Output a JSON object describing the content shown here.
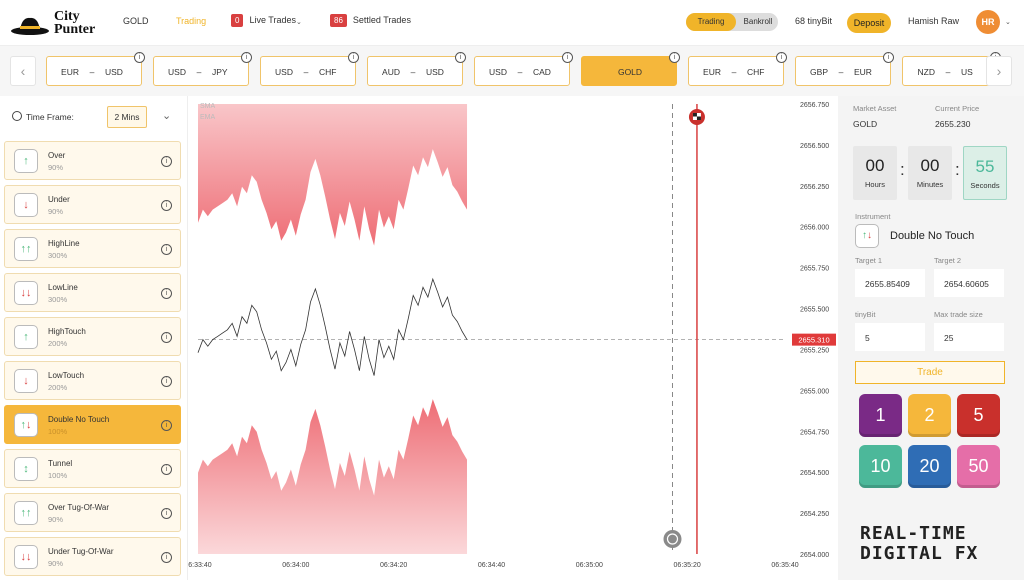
{
  "logo": {
    "line1": "City",
    "line2": "Punter"
  },
  "nav": {
    "asset": "GOLD",
    "trading": "Trading",
    "live_count": "0",
    "live_label": "Live Trades",
    "settled_count": "86",
    "settled_label": "Settled Trades",
    "mode_on": "Trading",
    "mode_off": "Bankroll",
    "balance": "68 tinyBit",
    "deposit": "Deposit",
    "user": "Hamish Raw",
    "initials": "HR"
  },
  "pairs": [
    {
      "a": "EUR",
      "b": "USD"
    },
    {
      "a": "USD",
      "b": "JPY"
    },
    {
      "a": "USD",
      "b": "CHF"
    },
    {
      "a": "AUD",
      "b": "USD"
    },
    {
      "a": "USD",
      "b": "CAD"
    },
    {
      "single": "GOLD"
    },
    {
      "a": "EUR",
      "b": "CHF"
    },
    {
      "a": "GBP",
      "b": "EUR"
    },
    {
      "a": "NZD",
      "b": "US"
    }
  ],
  "timeframe": {
    "label": "Time Frame:",
    "value": "2 Mins"
  },
  "options": [
    {
      "name": "Over",
      "pct": "90%",
      "icon": "↑"
    },
    {
      "name": "Under",
      "pct": "90%",
      "icon": "↓"
    },
    {
      "name": "HighLine",
      "pct": "300%",
      "icon": "↑↑"
    },
    {
      "name": "LowLine",
      "pct": "300%",
      "icon": "↓↓"
    },
    {
      "name": "HighTouch",
      "pct": "200%",
      "icon": "↑"
    },
    {
      "name": "LowTouch",
      "pct": "200%",
      "icon": "↓"
    },
    {
      "name": "Double No Touch",
      "pct": "100%",
      "icon": "↑↓"
    },
    {
      "name": "Tunnel",
      "pct": "100%",
      "icon": "↕"
    },
    {
      "name": "Over Tug-Of-War",
      "pct": "90%",
      "icon": "↑↑"
    },
    {
      "name": "Under Tug-Of-War",
      "pct": "90%",
      "icon": "↓↓"
    }
  ],
  "chart_data": {
    "type": "line",
    "legend": [
      "SMA",
      "EMA"
    ],
    "current_price_tag": "2655.310",
    "y_ticks": [
      "2656.750",
      "2656.500",
      "2656.250",
      "2656.000",
      "2655.750",
      "2655.500",
      "2655.250",
      "2655.000",
      "2654.750",
      "2654.500",
      "2654.250",
      "2654.000"
    ],
    "x_ticks": [
      "06:33:40",
      "06:34:00",
      "06:34:20",
      "06:34:40",
      "06:35:00",
      "06:35:20",
      "06:35:40"
    ],
    "ylim": [
      2654.0,
      2656.75
    ],
    "xlim_seconds": [
      0,
      120
    ],
    "price_series": [
      [
        0,
        2655.23
      ],
      [
        1,
        2655.31
      ],
      [
        2,
        2655.27
      ],
      [
        3,
        2655.31
      ],
      [
        4,
        2655.33
      ],
      [
        5,
        2655.35
      ],
      [
        6,
        2655.37
      ],
      [
        7,
        2655.41
      ],
      [
        8,
        2655.33
      ],
      [
        9,
        2655.45
      ],
      [
        10,
        2655.41
      ],
      [
        11,
        2655.52
      ],
      [
        12,
        2655.48
      ],
      [
        13,
        2655.37
      ],
      [
        14,
        2655.29
      ],
      [
        15,
        2655.19
      ],
      [
        16,
        2655.24
      ],
      [
        17,
        2655.12
      ],
      [
        18,
        2655.17
      ],
      [
        19,
        2655.25
      ],
      [
        20,
        2655.15
      ],
      [
        21,
        2655.28
      ],
      [
        22,
        2655.37
      ],
      [
        23,
        2655.54
      ],
      [
        24,
        2655.62
      ],
      [
        25,
        2655.52
      ],
      [
        26,
        2655.39
      ],
      [
        27,
        2655.25
      ],
      [
        28,
        2655.13
      ],
      [
        29,
        2655.29
      ],
      [
        30,
        2655.21
      ],
      [
        31,
        2655.36
      ],
      [
        32,
        2655.25
      ],
      [
        33,
        2655.12
      ],
      [
        34,
        2655.33
      ],
      [
        35,
        2655.19
      ],
      [
        36,
        2655.09
      ],
      [
        37,
        2655.31
      ],
      [
        38,
        2655.2
      ],
      [
        39,
        2655.27
      ],
      [
        40,
        2655.19
      ],
      [
        41,
        2655.37
      ],
      [
        42,
        2655.31
      ],
      [
        43,
        2655.44
      ],
      [
        44,
        2655.58
      ],
      [
        45,
        2655.52
      ],
      [
        46,
        2655.63
      ],
      [
        47,
        2655.57
      ],
      [
        48,
        2655.68
      ],
      [
        49,
        2655.6
      ],
      [
        50,
        2655.51
      ],
      [
        51,
        2655.57
      ],
      [
        52,
        2655.46
      ],
      [
        53,
        2655.42
      ],
      [
        54,
        2655.36
      ],
      [
        55,
        2655.31
      ]
    ],
    "dashed_price": 2655.31,
    "now_x": 97,
    "expiry_x": 102
  },
  "right": {
    "market_label": "Market Asset",
    "market_value": "GOLD",
    "price_label": "Current Price",
    "price_value": "2655.230",
    "hours": "00",
    "hours_label": "Hours",
    "minutes": "00",
    "minutes_label": "Minutes",
    "seconds": "55",
    "seconds_label": "Seconds",
    "instrument_label": "Instrument",
    "instrument_name": "Double No Touch",
    "t1_label": "Target 1",
    "t1": "2655.85409",
    "t2_label": "Target 2",
    "t2": "2654.60605",
    "tiny_label": "tinyBit",
    "tiny": "5",
    "max_label": "Max trade size",
    "max": "25",
    "trade": "Trade",
    "chips": [
      "1",
      "2",
      "5",
      "10",
      "20",
      "50"
    ],
    "chip_colors": [
      "#7a2a86",
      "#f5b73b",
      "#c9302c",
      "#4cb89a",
      "#2f6db5",
      "#e56ea8"
    ],
    "brand1": "REAL-TIME",
    "brand2": "DIGITAL FX"
  }
}
